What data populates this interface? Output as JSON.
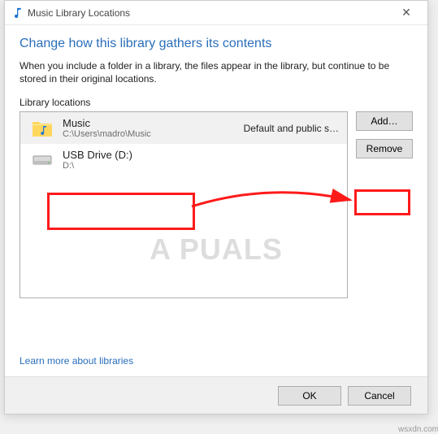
{
  "window": {
    "title": "Music Library Locations",
    "close_glyph": "✕"
  },
  "main": {
    "heading": "Change how this library gathers its contents",
    "description": "When you include a folder in a library, the files appear in the library, but continue to be stored in their original locations.",
    "locations_label": "Library locations",
    "learn_more": "Learn more about libraries"
  },
  "list": {
    "music": {
      "name": "Music",
      "path": "C:\\Users\\madro\\Music",
      "badge": "Default and public s…"
    },
    "usb": {
      "name": "USB Drive (D:)",
      "path": "D:\\"
    }
  },
  "buttons": {
    "add": "Add…",
    "remove": "Remove",
    "ok": "OK",
    "cancel": "Cancel"
  },
  "watermark": "A PUALS",
  "watermark_source": "wsxdn.com"
}
